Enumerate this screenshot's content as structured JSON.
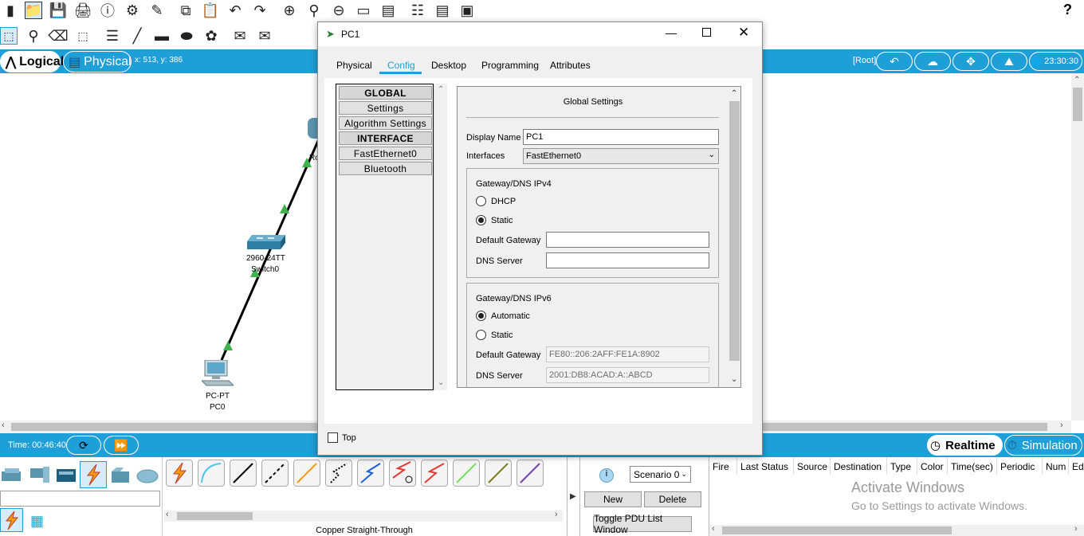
{
  "toolbar": {
    "help": "?"
  },
  "modebar": {
    "logical": "Logical",
    "physical": "Physical",
    "coords": "x: 513, y: 386",
    "root": "[Root]",
    "clock": "23:30:30"
  },
  "workspace": {
    "router_label": "Ro",
    "switch_model": "2960-24TT",
    "switch_name": "Switch0",
    "pc_model": "PC-PT",
    "pc_name": "PC0"
  },
  "dialog": {
    "title": "PC1",
    "tabs": [
      "Physical",
      "Config",
      "Desktop",
      "Programming",
      "Attributes"
    ],
    "active_tab": "Config",
    "left_menu": [
      "GLOBAL",
      "Settings",
      "Algorithm Settings",
      "INTERFACE",
      "FastEthernet0",
      "Bluetooth"
    ],
    "settings_title": "Global Settings",
    "display_name_label": "Display Name",
    "display_name_value": "PC1",
    "interfaces_label": "Interfaces",
    "interfaces_value": "FastEthernet0",
    "ipv4": {
      "title": "Gateway/DNS IPv4",
      "dhcp": "DHCP",
      "static": "Static",
      "selected": "Static",
      "gateway_label": "Default Gateway",
      "gateway_value": "",
      "dns_label": "DNS Server",
      "dns_value": ""
    },
    "ipv6": {
      "title": "Gateway/DNS IPv6",
      "automatic": "Automatic",
      "static": "Static",
      "selected": "Automatic",
      "gateway_label": "Default Gateway",
      "gateway_value": "FE80::206:2AFF:FE1A:8902",
      "dns_label": "DNS Server",
      "dns_value": "2001:DB8:ACAD:A::ABCD"
    },
    "top_checkbox": "Top"
  },
  "bottombar": {
    "time": "Time: 00:46:40",
    "realtime": "Realtime",
    "simulation": "Simulation"
  },
  "bottom": {
    "cable_caption": "Copper Straight-Through",
    "scenario": "Scenario 0",
    "new_button": "New",
    "delete_button": "Delete",
    "toggle_button": "Toggle PDU List Window",
    "pdu_columns": [
      "Fire",
      "Last Status",
      "Source",
      "Destination",
      "Type",
      "Color",
      "Time(sec)",
      "Periodic",
      "Num",
      "Ed"
    ],
    "watermark_title": "Activate Windows",
    "watermark_sub": "Go to Settings to activate Windows."
  },
  "colors": {
    "accent": "#1e9fd8",
    "active_tab": "#1e9fd8",
    "link_green": "#3cb44b"
  }
}
